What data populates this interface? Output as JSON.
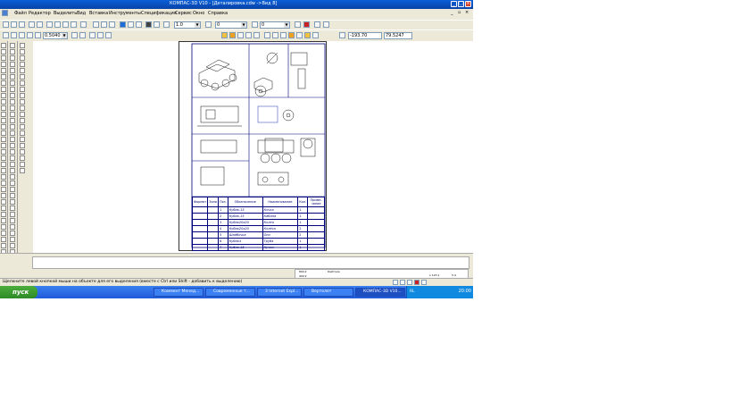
{
  "window": {
    "title": "КОМПАС-3D V10 - [Деталировка.cdw ->Вид 8]"
  },
  "menu": [
    "Файл",
    "Редактор",
    "Выделить",
    "Вид",
    "Вставка",
    "Инструменты",
    "Спецификация",
    "Сервис",
    "Окно",
    "Справка"
  ],
  "toolbar": {
    "step_value": "1.0",
    "layer_value": "0",
    "style_value": "0",
    "zoom_value": "0.5040",
    "coord_x": "-193.70",
    "coord_y": "79.5247"
  },
  "spec_table": {
    "headers": {
      "format": "Формат",
      "zone": "Зона",
      "pos": "Поз.",
      "designation": "Обозначение",
      "name": "Наименование",
      "qty": "Кол.",
      "note": "Приме-чание"
    },
    "rows": [
      {
        "pos": "1",
        "designation": "Кубик-15",
        "name": "Кочка",
        "qty": "1"
      },
      {
        "pos": "2",
        "designation": "Кубик-15",
        "name": "Кабина",
        "qty": "1"
      },
      {
        "pos": "3",
        "designation": "Кубик20х20",
        "name": "Колея",
        "qty": "1"
      },
      {
        "pos": "4",
        "designation": "Кубик20х20",
        "name": "Колёса",
        "qty": "2"
      },
      {
        "pos": "5",
        "designation": "Шайбочка",
        "name": "Оси",
        "qty": "2"
      },
      {
        "pos": "6",
        "designation": "Кубик4",
        "name": "Труба",
        "qty": "1"
      },
      {
        "pos": "7",
        "designation": "Кубик-15",
        "name": "Кучки",
        "qty": "1"
      }
    ]
  },
  "bottom_panel": {
    "title": "Кайтома",
    "scale_labels": [
      "800.2",
      "400.2",
      "200.2",
      "100.2",
      "0.0"
    ],
    "readout_left": "1 123,1",
    "readout_right": "5.4"
  },
  "status": {
    "hint": "Щелкните левой кнопкой мыши на объекте для его выделения (вместе с Ctrl или Shift - добавить к выделению)"
  },
  "taskbar": {
    "start_label": "пуск",
    "tasks": [
      "Коммент Менед...",
      "Современные т...",
      "3 Internet Expl...",
      "Вертолет",
      "КОМПАС-3D V10..."
    ],
    "tray_lang": "RL",
    "clock": "20:00"
  },
  "colors": {
    "titlebar": "#0a5fd8",
    "taskbar": "#245edb",
    "start": "#3c9a2e",
    "frame": "#00007a"
  }
}
